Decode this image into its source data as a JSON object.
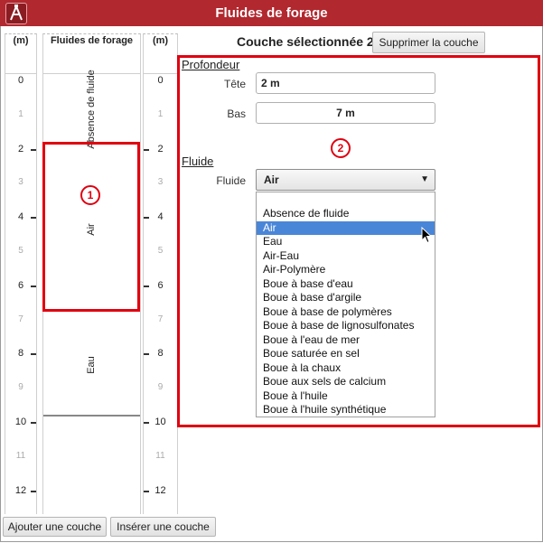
{
  "window": {
    "title": "Fluides de forage"
  },
  "columns": {
    "left_header": "(m)",
    "middle_header": "Fluides de forage",
    "right_header": "(m)"
  },
  "depth_scale": {
    "major": [
      "0",
      "2",
      "4",
      "6",
      "8",
      "10",
      "12"
    ],
    "minor": [
      "1",
      "3",
      "5",
      "7",
      "9",
      "11"
    ]
  },
  "layers": [
    {
      "label": "Absence de fluide"
    },
    {
      "label": "Air"
    },
    {
      "label": "Eau"
    }
  ],
  "annotations": {
    "badge1": "1",
    "badge2": "2"
  },
  "header": {
    "selected_layer_text": "Couche sélectionnée 2",
    "delete_button": "Supprimer la couche"
  },
  "profondeur": {
    "section_title": "Profondeur",
    "tete_label": "Tête",
    "tete_value": "2 m",
    "bas_label": "Bas",
    "bas_value": "7 m"
  },
  "fluide": {
    "section_title": "Fluide",
    "label": "Fluide",
    "selected": "Air",
    "options": [
      "Absence de fluide",
      "Air",
      "Eau",
      "Air-Eau",
      "Air-Polymère",
      "Boue à base d'eau",
      "Boue à base d'argile",
      "Boue à base de polymères",
      "Boue à base de lignosulfonates",
      "Boue à l'eau de mer",
      "Boue saturée en sel",
      "Boue à la chaux",
      "Boue aux sels de calcium",
      "Boue à l'huile",
      "Boue à l'huile synthétique"
    ]
  },
  "footer": {
    "add_button": "Ajouter une couche",
    "insert_button": "Insérer une couche"
  },
  "colors": {
    "title_bar": "#b1282f",
    "highlight": "#e00010",
    "selected_option": "#4a86d8"
  }
}
